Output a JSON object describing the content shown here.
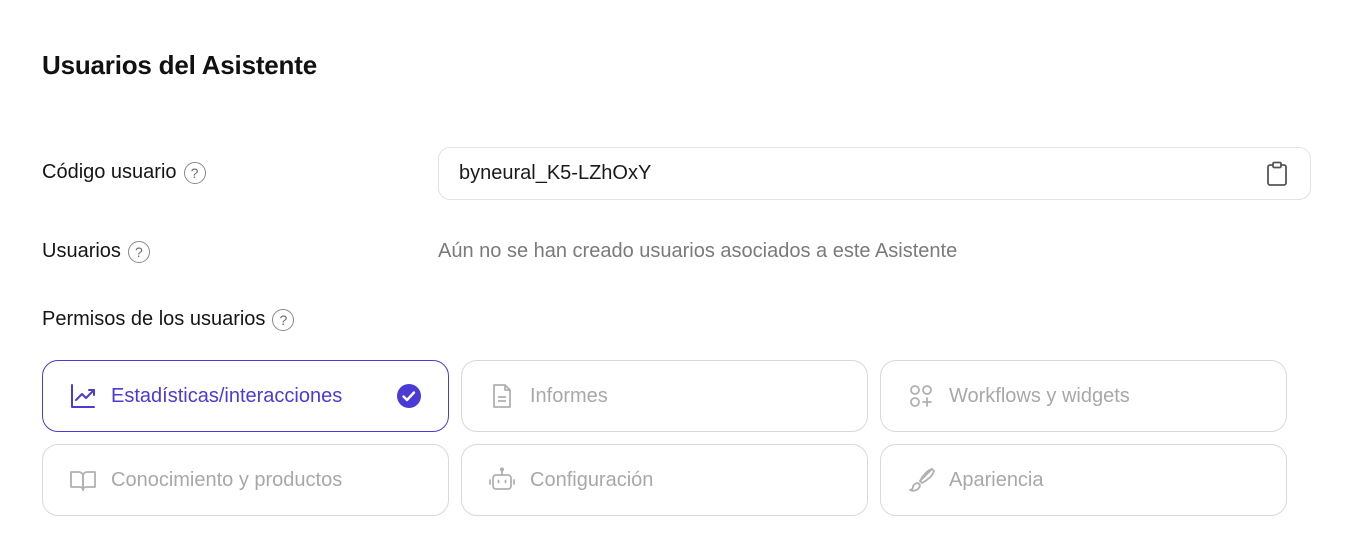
{
  "page": {
    "title": "Usuarios del Asistente"
  },
  "user_code": {
    "label": "Código usuario",
    "help": "?",
    "value": "byneural_K5-LZhOxY",
    "copy_icon": "clipboard-icon"
  },
  "users": {
    "label": "Usuarios",
    "help": "?",
    "empty_message": "Aún no se han creado usuarios asociados a este Asistente"
  },
  "permissions": {
    "label": "Permisos de los usuarios",
    "help": "?",
    "items": [
      {
        "label": "Estadísticas/interacciones",
        "icon": "line-chart-icon",
        "selected": true
      },
      {
        "label": "Informes",
        "icon": "document-icon",
        "selected": false
      },
      {
        "label": "Workflows y widgets",
        "icon": "shapes-plus-icon",
        "selected": false
      },
      {
        "label": "Conocimiento y productos",
        "icon": "open-book-icon",
        "selected": false
      },
      {
        "label": "Configuración",
        "icon": "robot-icon",
        "selected": false
      },
      {
        "label": "Apariencia",
        "icon": "paintbrush-icon",
        "selected": false
      }
    ]
  },
  "colors": {
    "accent": "#4b3bd6",
    "muted": "#a8a8a8",
    "border": "#d9d9d9"
  }
}
